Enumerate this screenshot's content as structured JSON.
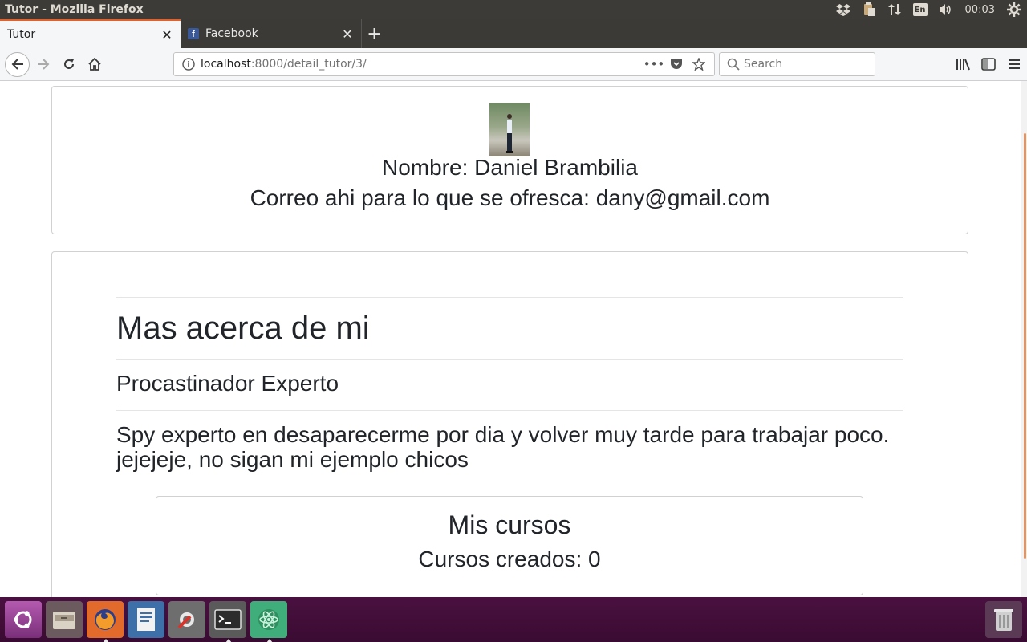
{
  "os": {
    "window_title": "Tutor - Mozilla Firefox",
    "keyboard_layout": "En",
    "clock": "00:03"
  },
  "browser": {
    "tabs": [
      {
        "label": "Tutor",
        "active": true
      },
      {
        "label": "Facebook",
        "active": false
      }
    ],
    "url_host": "localhost",
    "url_path": ":8000/detail_tutor/3/",
    "search_placeholder": "Search",
    "accent_color": "#e0612c"
  },
  "profile": {
    "name_line": "Nombre: Daniel Brambilia",
    "email_line": "Correo ahi para lo que se ofresca: dany@gmail.com"
  },
  "about": {
    "heading": "Mas acerca de mi",
    "subtitle": "Procastinador Experto",
    "description": "Spy experto en desaparecerme por dia y volver muy tarde para trabajar poco. jejejeje, no sigan mi ejemplo chicos"
  },
  "courses": {
    "title": "Mis cursos",
    "count_line": "Cursos creados: 0"
  },
  "dock": {
    "items": [
      "ubuntu-dash-icon",
      "files-icon",
      "firefox-icon",
      "writer-icon",
      "system-settings-icon",
      "terminal-icon",
      "atom-icon"
    ],
    "trash": "trash-icon"
  }
}
